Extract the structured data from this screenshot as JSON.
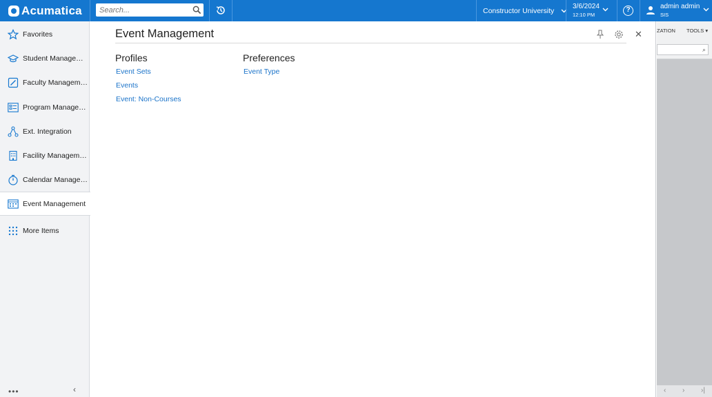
{
  "app": {
    "brand": "Acumatica"
  },
  "search": {
    "placeholder": "Search..."
  },
  "header": {
    "company": "Constructor University",
    "date": "3/6/2024",
    "time": "12:10 PM",
    "user_name": "admin admin",
    "user_sub": "SIS",
    "accent_color": "#1577cf"
  },
  "sidebar": {
    "items": [
      {
        "label": "Favorites",
        "icon": "star-icon"
      },
      {
        "label": "Student Management",
        "icon": "graduation-cap-icon"
      },
      {
        "label": "Faculty Management",
        "icon": "edit-icon"
      },
      {
        "label": "Program Management",
        "icon": "list-board-icon"
      },
      {
        "label": "Ext. Integration",
        "icon": "network-icon"
      },
      {
        "label": "Facility Management",
        "icon": "building-icon"
      },
      {
        "label": "Calendar Management",
        "icon": "stopwatch-icon"
      },
      {
        "label": "Event Management",
        "icon": "calendar-grid-icon",
        "active": true
      },
      {
        "label": "More Items",
        "icon": "grid-dots-icon"
      }
    ]
  },
  "panel": {
    "title": "Event Management",
    "columns": [
      {
        "heading": "Profiles",
        "links": [
          "Event Sets",
          "Events",
          "Event: Non-Courses"
        ]
      },
      {
        "heading": "Preferences",
        "links": [
          "Event Type"
        ]
      }
    ]
  },
  "background": {
    "toolbar_left": "ZATION",
    "toolbar_right": "TOOLS"
  }
}
